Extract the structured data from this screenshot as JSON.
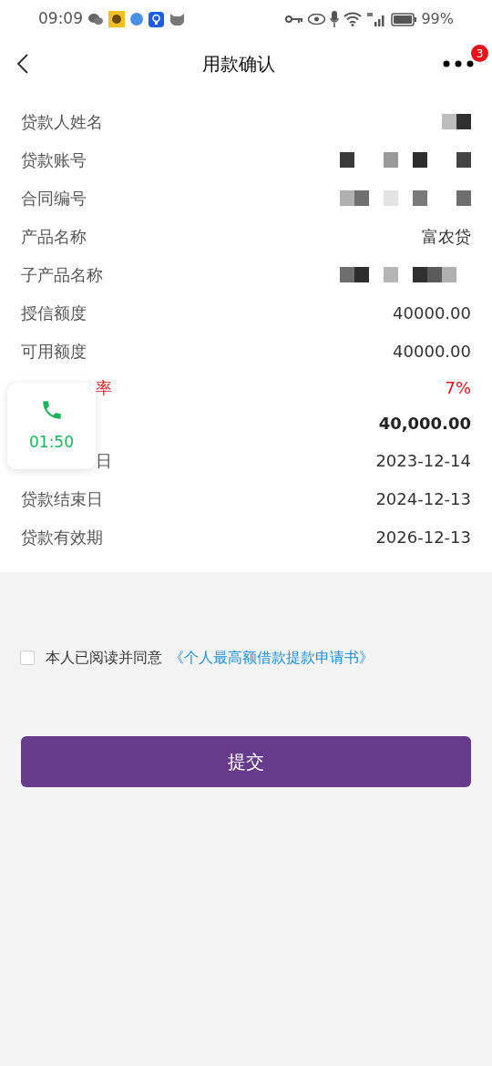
{
  "status_bar": {
    "time": "09:09",
    "battery": "99%"
  },
  "header": {
    "title": "用款确认",
    "badge": "3"
  },
  "rows": [
    {
      "label": "贷款人姓名",
      "kind": "redacted"
    },
    {
      "label": "贷款账号",
      "kind": "redacted"
    },
    {
      "label": "合同编号",
      "kind": "redacted"
    },
    {
      "label": "产品名称",
      "kind": "plain",
      "value": "富农贷"
    },
    {
      "label": "子产品名称",
      "kind": "redacted"
    },
    {
      "label": "授信额度",
      "kind": "plain",
      "value": "40000.00"
    },
    {
      "label": "可用额度",
      "kind": "plain",
      "value": "40000.00"
    },
    {
      "label": "率",
      "kind": "rate",
      "value": "7%"
    },
    {
      "kind": "amount",
      "value": "40,000.00"
    },
    {
      "label": "日",
      "kind": "plain",
      "value": "2023-12-14"
    },
    {
      "label": "贷款结束日",
      "kind": "plain",
      "value": "2024-12-13"
    },
    {
      "label": "贷款有效期",
      "kind": "plain",
      "value": "2026-12-13"
    }
  ],
  "call_widget": {
    "timer": "01:50"
  },
  "agreement": {
    "checked": false,
    "text": "本人已阅读并同意",
    "link": "《个人最高额借款提款申请书》"
  },
  "submit": "提交"
}
